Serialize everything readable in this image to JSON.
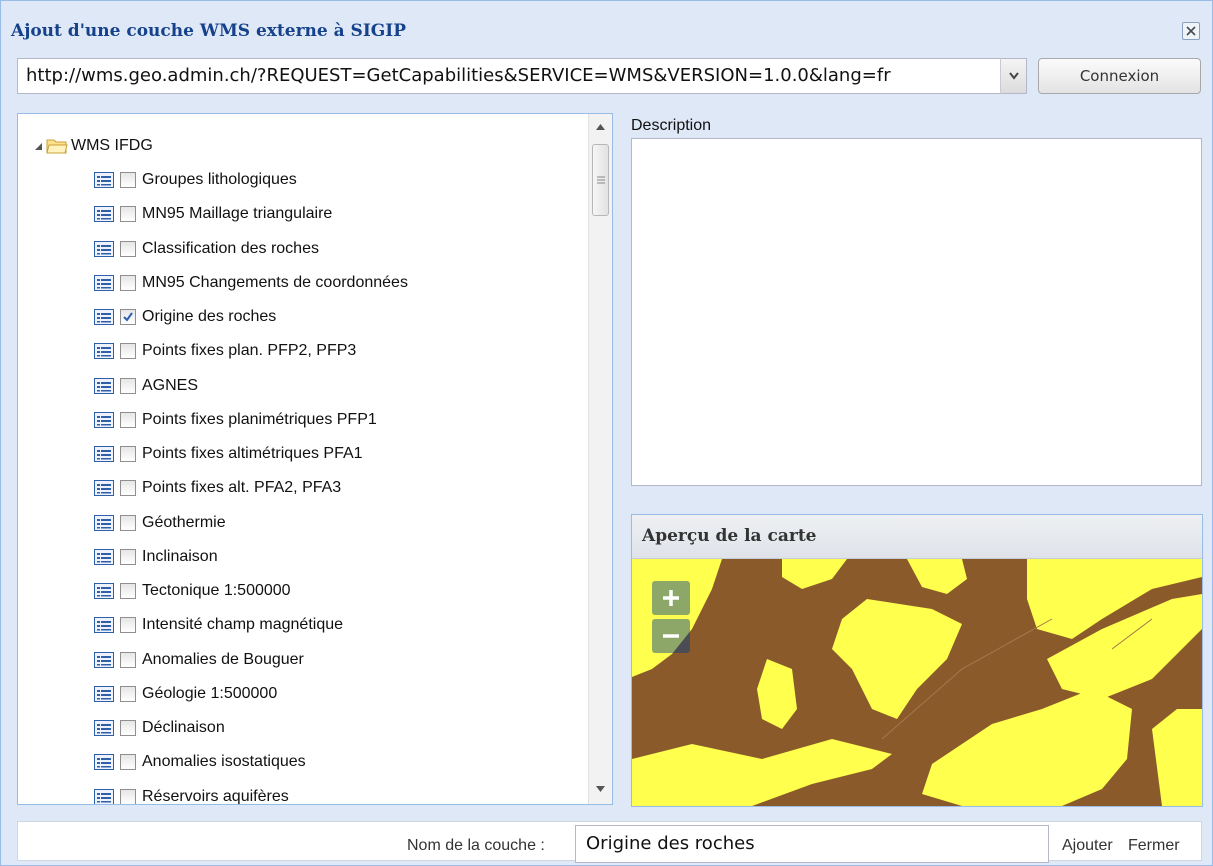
{
  "window": {
    "title": "Ajout d'une couche WMS externe à SIGIP",
    "close_icon": "close-x-icon"
  },
  "url_bar": {
    "value": "http://wms.geo.admin.ch/?REQUEST=GetCapabilities&SERVICE=WMS&VERSION=1.0.0&lang=fr",
    "dropdown_icon": "chevron-down-icon",
    "connect_label": "Connexion"
  },
  "tree": {
    "root_label": "WMS IFDG",
    "items": [
      {
        "label": "Groupes lithologiques",
        "checked": false
      },
      {
        "label": "MN95 Maillage triangulaire",
        "checked": false
      },
      {
        "label": "Classification des roches",
        "checked": false
      },
      {
        "label": "MN95 Changements de coordonnées",
        "checked": false
      },
      {
        "label": "Origine des roches",
        "checked": true
      },
      {
        "label": "Points fixes plan. PFP2, PFP3",
        "checked": false
      },
      {
        "label": "AGNES",
        "checked": false
      },
      {
        "label": "Points fixes planimétriques PFP1",
        "checked": false
      },
      {
        "label": "Points fixes altimétriques PFA1",
        "checked": false
      },
      {
        "label": "Points fixes alt. PFA2, PFA3",
        "checked": false
      },
      {
        "label": "Géothermie",
        "checked": false
      },
      {
        "label": "Inclinaison",
        "checked": false
      },
      {
        "label": "Tectonique 1:500000",
        "checked": false
      },
      {
        "label": "Intensité champ magnétique",
        "checked": false
      },
      {
        "label": "Anomalies de Bouguer",
        "checked": false
      },
      {
        "label": "Géologie 1:500000",
        "checked": false
      },
      {
        "label": "Déclinaison",
        "checked": false
      },
      {
        "label": "Anomalies isostatiques",
        "checked": false
      },
      {
        "label": "Réservoirs aquifères",
        "checked": false
      }
    ]
  },
  "description": {
    "label": "Description",
    "text": ""
  },
  "map_preview": {
    "title": "Aperçu de la carte",
    "colors": {
      "background": "#8b5a2b",
      "formation": "#ffff4d"
    }
  },
  "footer": {
    "name_label": "Nom de la couche :",
    "name_value": "Origine des roches",
    "add_label": "Ajouter",
    "close_label": "Fermer"
  }
}
